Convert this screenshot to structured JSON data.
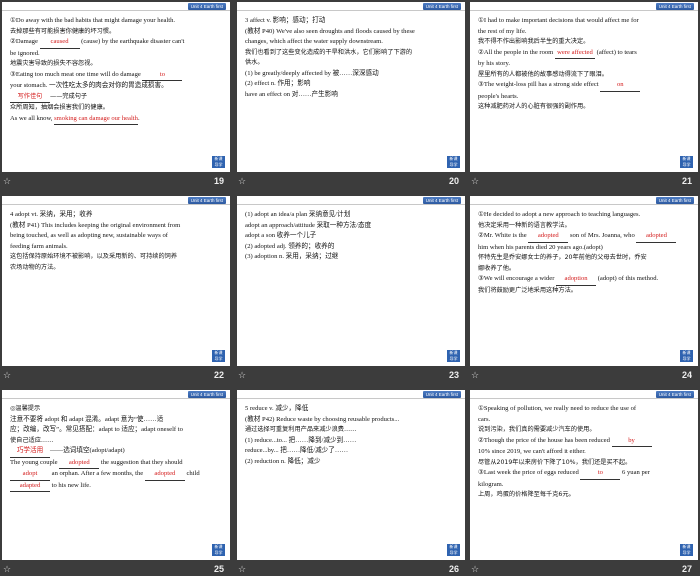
{
  "unit_label": "Unit 4  Earth first",
  "logo_text": "新课\n导学",
  "slides": [
    {
      "number": "19",
      "lines": [
        "①Do away with the bad habits that might damage your health.",
        "去掉那些有可能损害你健康的坏习惯。",
        "②Damage [caused] (cause) by the earthquake disaster can't",
        "be ignored.",
        "地震灾害导致的损失不容忽视。",
        "③Eating too much meat one time will do damage [to]",
        "your stomach.   一次性吃太多的肉会对你的胃造成损害。",
        "[写作佳句]——完成句子",
        "众所周知，抽烟会损害我们的健康。",
        "As we all know, [smoking can damage our health]."
      ]
    },
    {
      "number": "20",
      "lines": [
        "3 affect  v. 影响；感动；打动",
        "(教材 P40) We've also seen droughts and floods caused by these",
        "changes, which affect the water supply downstream.",
        "我们也看到了这些变化造成的干旱和洪水，它们影响了下游的",
        "供水。",
        "(1) be greatly/deeply affected by     被……深深感动",
        "(2) effect n.                           作用；影响",
        "have an effect on                       对……产生影响"
      ]
    },
    {
      "number": "21",
      "lines": [
        "①I had to make important decisions that would affect me for",
        "the rest of my life.",
        "我不得不作出影响我后半生的重大决定。",
        "②All the people in the room [were affected] (affect) to tears",
        "by his story.",
        "屋里所有的人都被他的故事感动得流下了眼泪。",
        "③The weight-loss pill has a strong side effect [on]",
        "people's hearts.",
        "这种减肥药对人的心脏有很强的副作用。"
      ]
    },
    {
      "number": "22",
      "lines": [
        "4 adopt  vt. 采纳，采用；收养",
        "(教材 P41) This includes keeping the original environment from",
        "being touched, as well as adopting new, sustainable ways of",
        "feeding farm animals.",
        "这包括保持原始环境不被影响，以及采用新的、可持续的饲养",
        "农场动物的方法。"
      ]
    },
    {
      "number": "23",
      "lines": [
        "(1) adopt an idea/a plan          采纳意见/计划",
        "adopt an approach/attitude        采取一种方法/态度",
        "adopt a son                       收养一个儿子",
        "(2) adopted adj.                  领养的；收养的",
        "(3) adoption n.                   采用，采纳；过继"
      ]
    },
    {
      "number": "24",
      "lines": [
        "①He decided to adopt a new approach to teaching languages.",
        "他决定采用一种新的语言教学法。",
        "②Mr. White is the [adopted] son of Mrs. Joanna, who [adopted]",
        "him when his parents died 20 years ago.(adopt)",
        "怀特先生是乔安娜女士的养子，20年前他的父母去世时，乔安",
        "娜收养了他。",
        "③We will encourage a wider [adoption] (adopt) of this method.",
        "我们将鼓励更广泛地采用这种方法。"
      ]
    },
    {
      "number": "25",
      "lines": [
        "◎温馨提示",
        "注意不要将 adopt 和 adapt 混淆。adapt 意为“使……适",
        "应；改编，改写”。常见搭配：adapt to 适应；adapt oneself to",
        "使自己适应……",
        "[巧学活用]——选词填空(adopt/adapt)",
        "The young couple [adopted] the suggestion that they should",
        "[adopt] an orphan. After a few months, the [adopted] child",
        "[adapted] to his new life."
      ]
    },
    {
      "number": "26",
      "lines": [
        "5 reduce  v. 减少，降低",
        "(教材 P42) Reduce waste by choosing reusable products...",
        "通过选择可重复利用产品来减少浪费……",
        "(1) reduce...to...              把……降到/减少到……",
        "reduce...by...                  把……降低/减少了……",
        "(2) reduction n.                降低；减少"
      ]
    },
    {
      "number": "27",
      "lines": [
        "①Speaking of pollution, we really need to reduce the use of",
        "cars.",
        "说到污染，我们真的需要减少汽车的使用。",
        "②Though the price of the house has been reduced [by]",
        "10% since 2019, we can't afford it either.",
        "尽管从2019年以来房价下降了10%，我们还是买不起。",
        "③Last week the price of eggs reduced [to] 6 yuan per",
        "kilogram.",
        "上周，鸡蛋的价格降至每千克6元。"
      ]
    }
  ]
}
